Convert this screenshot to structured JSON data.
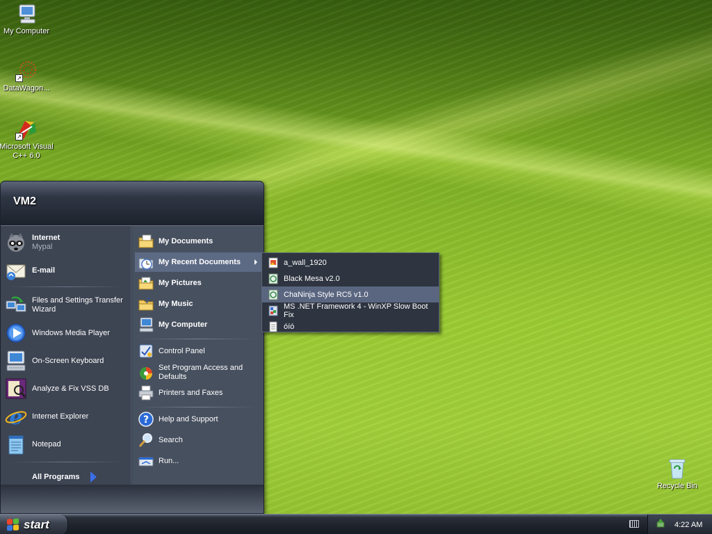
{
  "desktop": {
    "icons": [
      {
        "label": "My Computer",
        "icon": "computer-icon"
      },
      {
        "label": "DataWagon...",
        "icon": "datawagon-icon"
      },
      {
        "label": "Microsoft Visual C++ 6.0",
        "icon": "visual-cpp-icon"
      },
      {
        "label": "Recycle Bin",
        "icon": "recycle-bin-icon"
      }
    ]
  },
  "start_menu": {
    "user_name": "VM2",
    "left_items": [
      {
        "title": "Internet",
        "subtitle": "Mypal",
        "icon": "mypal-browser-icon"
      },
      {
        "title": "E-mail",
        "icon": "email-icon"
      },
      {
        "title": "Files and Settings Transfer Wizard",
        "icon": "transfer-wizard-icon"
      },
      {
        "title": "Windows Media Player",
        "icon": "media-player-icon"
      },
      {
        "title": "On-Screen Keyboard",
        "icon": "onscreen-keyboard-icon"
      },
      {
        "title": "Analyze & Fix VSS DB",
        "icon": "vss-db-icon"
      },
      {
        "title": "Internet Explorer",
        "icon": "internet-explorer-icon"
      },
      {
        "title": "Notepad",
        "icon": "notepad-icon"
      }
    ],
    "all_programs_label": "All Programs",
    "right_items": [
      {
        "label": "My Documents",
        "icon": "documents-folder-icon"
      },
      {
        "label": "My Recent Documents",
        "icon": "recent-documents-icon"
      },
      {
        "label": "My Pictures",
        "icon": "pictures-folder-icon"
      },
      {
        "label": "My Music",
        "icon": "music-folder-icon"
      },
      {
        "label": "My Computer",
        "icon": "computer-icon"
      },
      {
        "label": "Control Panel",
        "icon": "control-panel-icon"
      },
      {
        "label": "Set Program Access and Defaults",
        "icon": "program-defaults-icon"
      },
      {
        "label": "Printers and Faxes",
        "icon": "printer-icon"
      },
      {
        "label": "Help and Support",
        "icon": "help-icon"
      },
      {
        "label": "Search",
        "icon": "search-icon"
      },
      {
        "label": "Run...",
        "icon": "run-icon"
      }
    ],
    "highlighted_item": "My Recent Documents"
  },
  "recent_documents": {
    "items": [
      {
        "label": "a_wall_1920",
        "icon": "image-file-icon"
      },
      {
        "label": "Black Mesa v2.0",
        "icon": "document-file-icon"
      },
      {
        "label": "ChaNinja Style RC5 v1.0",
        "icon": "document-file-icon"
      },
      {
        "label": "MS .NET Framework 4 - WinXP Slow Boot Fix",
        "icon": "registry-file-icon"
      },
      {
        "label": "óíó",
        "icon": "text-file-icon"
      }
    ],
    "highlighted_item": "ChaNinja Style RC5 v1.0"
  },
  "taskbar": {
    "start_label": "start",
    "clock": "4:22 AM"
  },
  "colors": {
    "menu_bg": "#3d4452",
    "highlight": "#5d6a84",
    "accent_blue": "#3a6ee8"
  }
}
